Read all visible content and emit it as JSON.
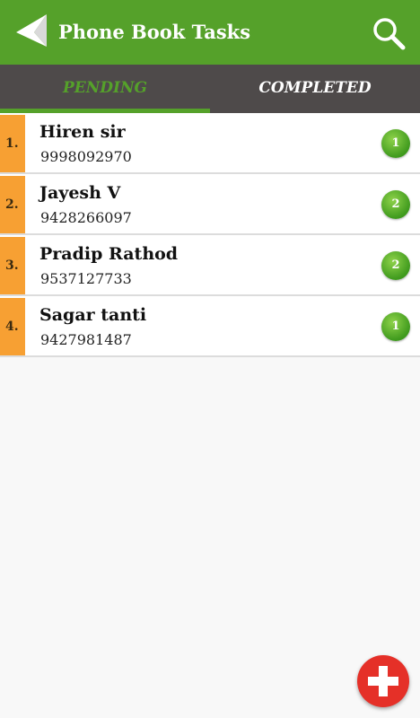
{
  "app": {
    "title": "Phone Book Tasks",
    "back_icon": "back-arrow-icon",
    "search_icon": "search-icon"
  },
  "tabs": [
    {
      "label": "PENDING",
      "active": true
    },
    {
      "label": "COMPLETED",
      "active": false
    }
  ],
  "tasks": [
    {
      "index": "1.",
      "name": "Hiren sir",
      "phone": "9998092970",
      "count": "1"
    },
    {
      "index": "2.",
      "name": "Jayesh V",
      "phone": "9428266097",
      "count": "2"
    },
    {
      "index": "3.",
      "name": "Pradip Rathod",
      "phone": "9537127733",
      "count": "2"
    },
    {
      "index": "4.",
      "name": "Sagar tanti",
      "phone": "9427981487",
      "count": "1"
    }
  ],
  "fab": {
    "icon": "plus-icon"
  },
  "colors": {
    "primary_green": "#55a12a",
    "tab_bar": "#4e4a4a",
    "index_orange": "#f7a033",
    "fab_red": "#e53028"
  }
}
